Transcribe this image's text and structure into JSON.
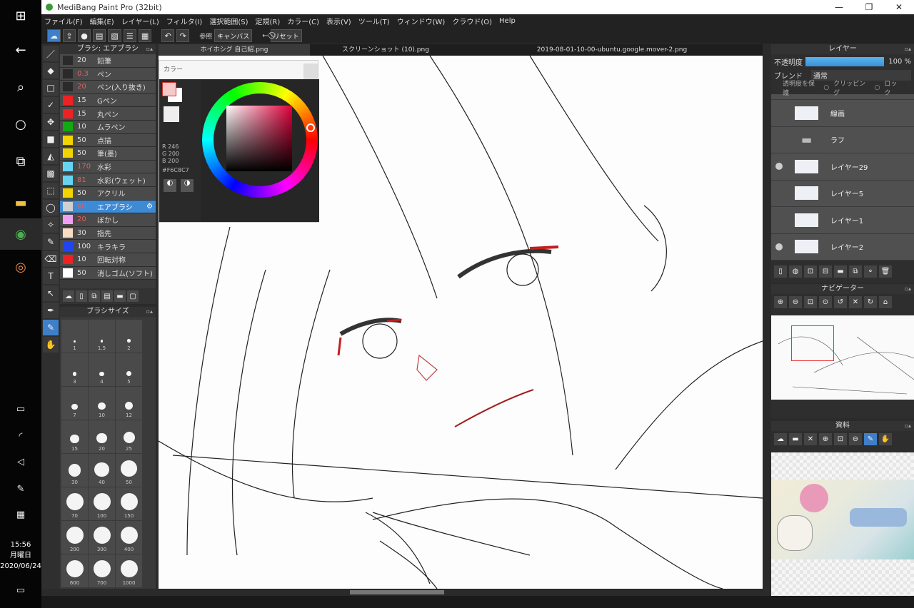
{
  "app": {
    "title": "MediBang Paint Pro (32bit)"
  },
  "taskbar": {
    "clock_time": "15:56",
    "clock_day": "月曜日",
    "clock_date": "2020/06/24"
  },
  "menu": [
    "ファイル(F)",
    "編集(E)",
    "レイヤー(L)",
    "フィルタ(I)",
    "選択範囲(S)",
    "定規(R)",
    "カラー(C)",
    "表示(V)",
    "ツール(T)",
    "ウィンドウ(W)",
    "クラウド(O)",
    "Help"
  ],
  "toolbar": {
    "ref_label": "参照",
    "canvas_label": "キャンバス",
    "reset_label": "リセット"
  },
  "tabs": [
    "ホイホシグ 自己紹.png",
    "スクリーンショット (10).png",
    "2019-08-01-10-00-ubuntu.google.mover-2.png"
  ],
  "brush_panel": {
    "title": "ブラシ: エアブラシ",
    "items": [
      {
        "size": "20",
        "name": "鉛筆",
        "color": "#2a2a2a",
        "red": false
      },
      {
        "size": "0.3",
        "name": "ペン",
        "color": "#2a2a2a",
        "red": true
      },
      {
        "size": "20",
        "name": "ペン(入り抜き)",
        "color": "#2a2a2a",
        "red": true
      },
      {
        "size": "15",
        "name": "Gペン",
        "color": "#ee2222",
        "red": false
      },
      {
        "size": "15",
        "name": "丸ペン",
        "color": "#ee2222",
        "red": false
      },
      {
        "size": "10",
        "name": "ムラペン",
        "color": "#11aa11",
        "red": false
      },
      {
        "size": "50",
        "name": "点描",
        "color": "#f2d400",
        "red": false
      },
      {
        "size": "50",
        "name": "筆(墨)",
        "color": "#f2d400",
        "red": false
      },
      {
        "size": "170",
        "name": "水彩",
        "color": "#66d4f0",
        "red": true
      },
      {
        "size": "81",
        "name": "水彩(ウェット)",
        "color": "#66d4f0",
        "red": true
      },
      {
        "size": "50",
        "name": "アクリル",
        "color": "#f2d400",
        "red": false
      },
      {
        "size": "60",
        "name": "エアブラシ",
        "color": "#cfcfcf",
        "red": true,
        "selected": true
      },
      {
        "size": "20",
        "name": "ぼかし",
        "color": "#f0a0f0",
        "red": true
      },
      {
        "size": "30",
        "name": "指先",
        "color": "#f8dcc4",
        "red": false
      },
      {
        "size": "100",
        "name": "キラキラ",
        "color": "#2244ee",
        "red": false
      },
      {
        "size": "10",
        "name": "回転対称",
        "color": "#ee2222",
        "red": false
      },
      {
        "size": "50",
        "name": "消しゴム(ソフト)",
        "color": "#ffffff",
        "red": false
      }
    ]
  },
  "brush_size_panel": {
    "title": "ブラシサイズ",
    "sizes": [
      "1",
      "1.5",
      "2",
      "3",
      "4",
      "5",
      "7",
      "10",
      "12",
      "15",
      "20",
      "25",
      "30",
      "40",
      "50",
      "70",
      "100",
      "150",
      "200",
      "300",
      "400",
      "600",
      "700",
      "1000"
    ]
  },
  "color_panel": {
    "title": "カラー",
    "r": "R 246",
    "g": "G 200",
    "b": "B 200",
    "hex": "#F6C8C7",
    "fg": "#f6c8c8",
    "bg": "#ffffff"
  },
  "layer_panel": {
    "title": "レイヤー",
    "opacity_label": "不透明度",
    "opacity_value": "100 %",
    "opacity": 100,
    "blend_label": "ブレンド",
    "blend_value": "通常",
    "protect_label": "透明度を保護",
    "clipping_label": "クリッピング",
    "lock_label": "ロック",
    "layers": [
      {
        "name": "線画",
        "visible": false
      },
      {
        "name": "ラフ",
        "visible": false,
        "folder": true
      },
      {
        "name": "レイヤー29",
        "visible": true
      },
      {
        "name": "レイヤー5",
        "visible": false
      },
      {
        "name": "レイヤー1",
        "visible": false
      },
      {
        "name": "レイヤー2",
        "visible": true
      }
    ]
  },
  "navigator": {
    "title": "ナビゲーター"
  },
  "materials": {
    "title": "資料"
  }
}
